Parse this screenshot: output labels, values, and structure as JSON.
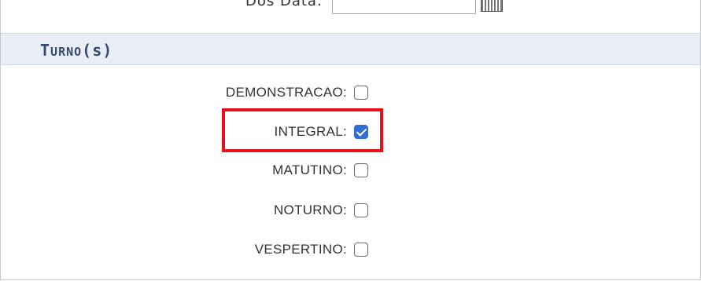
{
  "top_field": {
    "label": "Dos Data:",
    "value": ""
  },
  "section": {
    "title_first": "T",
    "title_rest": "URNO",
    "title_suffix": "(s)"
  },
  "options": [
    {
      "label": "DEMONSTRACAO:",
      "checked": false
    },
    {
      "label": "INTEGRAL:",
      "checked": true
    },
    {
      "label": "MATUTINO:",
      "checked": false
    },
    {
      "label": "NOTURNO:",
      "checked": false
    },
    {
      "label": "VESPERTINO:",
      "checked": false
    }
  ],
  "colors": {
    "header_bg": "#e9edf6",
    "checkbox_checked": "#2f6fd6",
    "highlight": "#e5121b"
  }
}
